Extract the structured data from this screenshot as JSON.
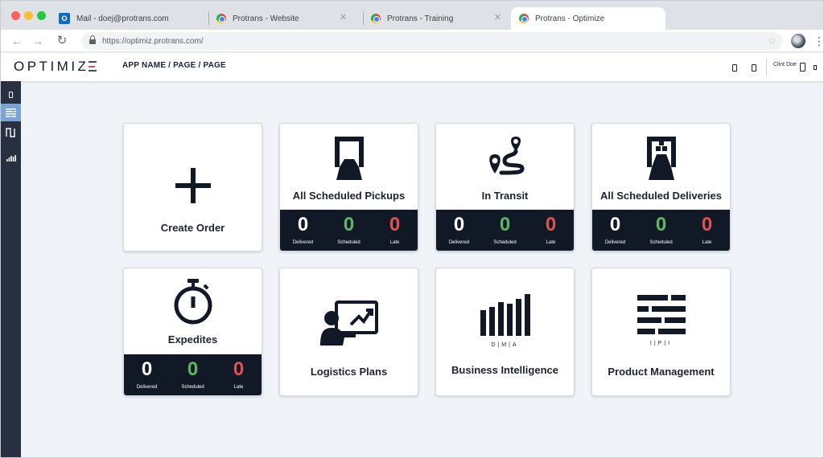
{
  "browser": {
    "tabs": [
      {
        "label": "Mail - doej@protrans.com",
        "favicon": "outlook-icon"
      },
      {
        "label": "Protrans - Website",
        "favicon": "chrome-icon"
      },
      {
        "label": "Protrans - Training",
        "favicon": "chrome-icon"
      },
      {
        "label": "Protrans - Optimize",
        "favicon": "chrome-icon",
        "active": true
      }
    ],
    "url": "https://optimiz.protrans.com/"
  },
  "header": {
    "logo_text": "OPTIMIZ",
    "breadcrumb": "APP NAME / PAGE / PAGE",
    "user_name": "Clint Doe"
  },
  "sidebar": {
    "items": [
      {
        "icon": "device-icon"
      },
      {
        "icon": "list-icon",
        "active": true
      },
      {
        "icon": "waveform-icon"
      },
      {
        "icon": "bar-chart-icon"
      }
    ]
  },
  "cards": [
    {
      "title": "Create Order",
      "icon": "plus-icon"
    },
    {
      "title": "All Scheduled Pickups",
      "icon": "truck-pickup-icon",
      "stats": [
        {
          "value": "0",
          "label": "Delivered"
        },
        {
          "value": "0",
          "label": "Scheduled"
        },
        {
          "value": "0",
          "label": "Late"
        }
      ]
    },
    {
      "title": "In Transit",
      "icon": "route-icon",
      "stats": [
        {
          "value": "0",
          "label": "Delivered"
        },
        {
          "value": "0",
          "label": "Scheduled"
        },
        {
          "value": "0",
          "label": "Late"
        }
      ]
    },
    {
      "title": "All Scheduled Deliveries",
      "icon": "truck-delivery-icon",
      "stats": [
        {
          "value": "0",
          "label": "Delivered"
        },
        {
          "value": "0",
          "label": "Scheduled"
        },
        {
          "value": "0",
          "label": "Late"
        }
      ]
    },
    {
      "title": "Expedites",
      "icon": "stopwatch-icon",
      "stats": [
        {
          "value": "0",
          "label": "Delivered"
        },
        {
          "value": "0",
          "label": "Scheduled"
        },
        {
          "value": "0",
          "label": "Late"
        }
      ]
    },
    {
      "title": "Logistics Plans",
      "icon": "presentation-icon"
    },
    {
      "title": "Business Intelligence",
      "icon": "bars-icon",
      "caption": "D|M|A"
    },
    {
      "title": "Product Management",
      "icon": "lines-icon",
      "caption": "I|P|I"
    }
  ],
  "colors": {
    "delivered": "#ffffff",
    "scheduled": "#5fb765",
    "late": "#e05252",
    "sidebar_bg": "#283041",
    "sidebar_active": "#7aa3d6",
    "stats_bg": "#121926"
  }
}
